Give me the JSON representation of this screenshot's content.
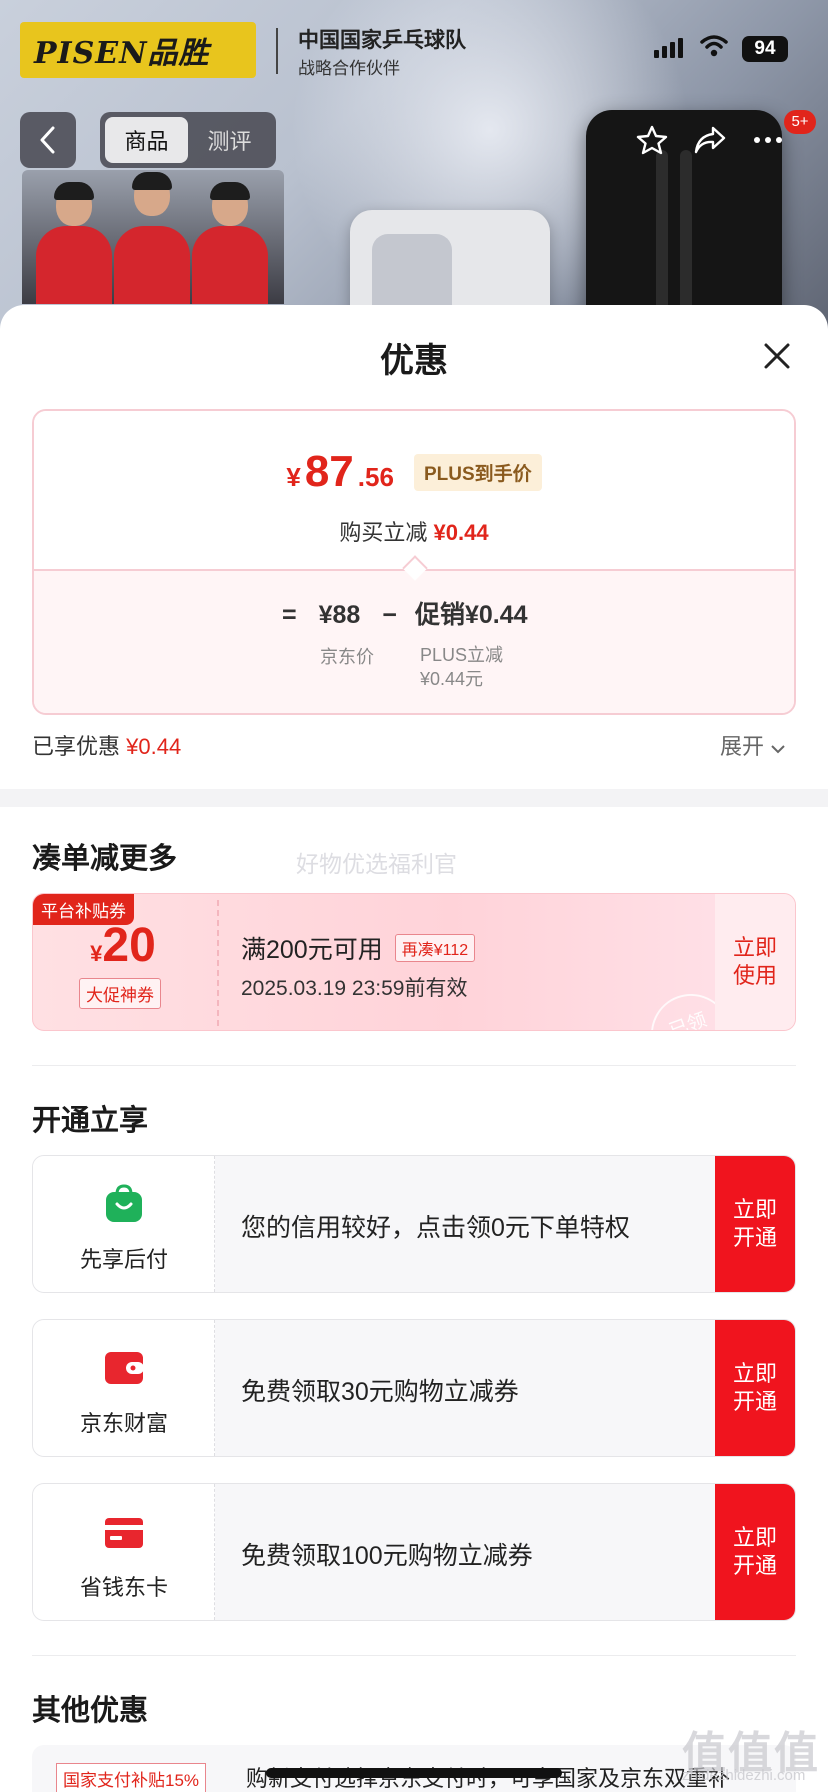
{
  "header": {
    "brand_logo": "PISEN品胜",
    "team_title": "中国国家乒乓球队",
    "team_sub": "战略合作伙伴",
    "battery_level": "94",
    "tabs": [
      "商品",
      "测评"
    ],
    "active_tab": 0,
    "more_badge": "5+"
  },
  "sheet": {
    "title": "优惠",
    "price": {
      "currency": "¥",
      "integer": "87",
      "decimal": ".56",
      "tag": "PLUS到手价",
      "reduce_label": "购买立减",
      "reduce_value": "¥0.44"
    },
    "calc": {
      "equals": "=",
      "base": "¥88",
      "minus": "−",
      "promo": "促销¥0.44",
      "base_label": "京东价",
      "promo_label_1": "PLUS立减",
      "promo_label_2": "¥0.44元"
    },
    "enjoyed_label": "已享优惠",
    "enjoyed_value": "¥0.44",
    "expand_label": "展开"
  },
  "coupon_section": {
    "title": "凑单减更多",
    "watermark": "好物优选福利官",
    "coupon": {
      "tag": "平台补贴券",
      "currency": "¥",
      "amount": "20",
      "kind": "大促神券",
      "condition": "满200元可用",
      "more": "再凑¥112",
      "valid": "2025.03.19 23:59前有效",
      "button": "立即使用",
      "stamp": "已领"
    }
  },
  "open_section": {
    "title": "开通立享",
    "items": [
      {
        "name": "先享后付",
        "icon": "shopping-bag-icon",
        "desc": "您的信用较好，点击领0元下单特权",
        "button": "立即开通",
        "color": "#1fb15a"
      },
      {
        "name": "京东财富",
        "icon": "wallet-icon",
        "desc": "免费领取30元购物立减券",
        "button": "立即开通",
        "color": "#e8262e"
      },
      {
        "name": "省钱东卡",
        "icon": "card-icon",
        "desc": "免费领取100元购物立减券",
        "button": "立即开通",
        "color": "#e8262e"
      }
    ]
  },
  "other_section": {
    "title": "其他优惠",
    "tag": "国家支付补贴15%",
    "text": "购新支付选择京东支付时，可享国家及京东双重补"
  },
  "site_watermark": {
    "mark": "值值值",
    "url": "zhidezhidezhi.com"
  },
  "colors": {
    "accent": "#e1251b",
    "button_red": "#f0141e"
  }
}
